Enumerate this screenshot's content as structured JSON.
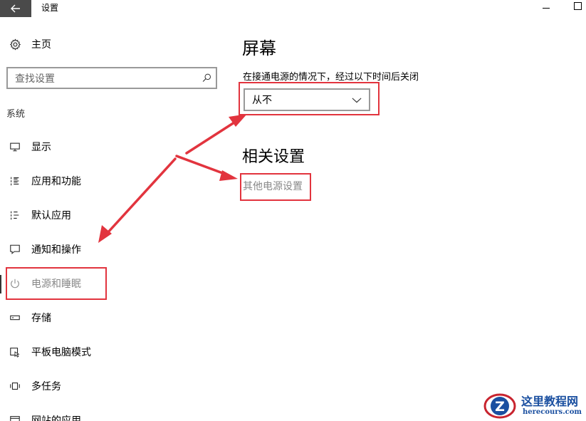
{
  "window": {
    "title": "设置",
    "back_icon": "arrow-left-icon",
    "minimize_icon": "minimize-icon",
    "maximize_icon": "maximize-icon"
  },
  "sidebar": {
    "home": {
      "label": "主页",
      "icon": "gear-icon"
    },
    "search": {
      "placeholder": "查找设置",
      "icon": "search-icon"
    },
    "section_label": "系统",
    "items": [
      {
        "label": "显示",
        "icon": "monitor-icon"
      },
      {
        "label": "应用和功能",
        "icon": "app-list-icon"
      },
      {
        "label": "默认应用",
        "icon": "default-apps-icon"
      },
      {
        "label": "通知和操作",
        "icon": "notification-icon"
      },
      {
        "label": "电源和睡眠",
        "icon": "power-icon",
        "active": true
      },
      {
        "label": "存储",
        "icon": "storage-icon"
      },
      {
        "label": "平板电脑模式",
        "icon": "tablet-mode-icon"
      },
      {
        "label": "多任务",
        "icon": "multitask-icon"
      },
      {
        "label": "网站的应用",
        "icon": "web-apps-icon"
      }
    ]
  },
  "main": {
    "screen_heading": "屏幕",
    "screen_description": "在接通电源的情况下，经过以下时间后关闭",
    "screen_timeout": {
      "value": "从不",
      "icon": "chevron-down-icon"
    },
    "related_heading": "相关设置",
    "related_link": "其他电源设置"
  },
  "annotation": {
    "color": "#e2343e"
  },
  "watermark": {
    "title": "这里教程网",
    "url": "herecours.com",
    "logo_letter": "Z",
    "color": "#1a4fa0"
  }
}
